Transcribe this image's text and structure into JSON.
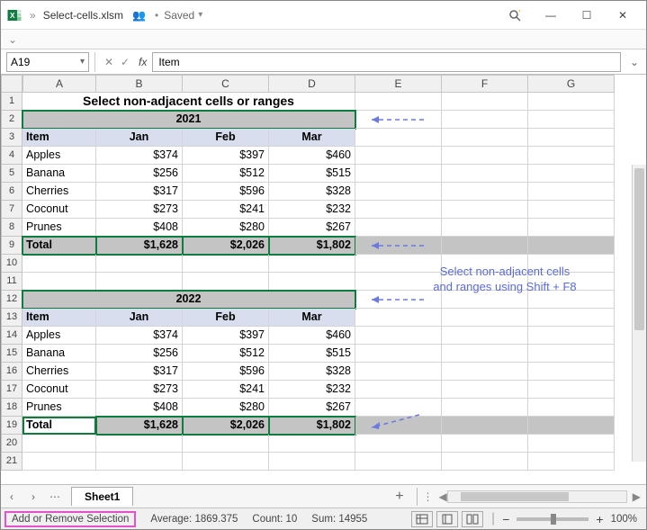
{
  "title": {
    "filename": "Select-cells.xlsm",
    "saved": "Saved"
  },
  "namebox": "A19",
  "formula": "Item",
  "colWidths": {
    "A": 82,
    "B": 96,
    "C": 96,
    "D": 96,
    "E": 96,
    "F": 96,
    "G": 96
  },
  "cols": [
    "A",
    "B",
    "C",
    "D",
    "E",
    "F",
    "G"
  ],
  "rows": [
    {
      "n": 1,
      "type": "title",
      "span": 4,
      "text": "Select non-adjacent cells or ranges"
    },
    {
      "n": 2,
      "type": "year",
      "span": 4,
      "text": "2021",
      "selected": true
    },
    {
      "n": 3,
      "type": "hdr",
      "cells": [
        "Item",
        "Jan",
        "Feb",
        "Mar"
      ]
    },
    {
      "n": 4,
      "type": "data",
      "cells": [
        "Apples",
        "$374",
        "$397",
        "$460"
      ]
    },
    {
      "n": 5,
      "type": "data",
      "cells": [
        "Banana",
        "$256",
        "$512",
        "$515"
      ]
    },
    {
      "n": 6,
      "type": "data",
      "cells": [
        "Cherries",
        "$317",
        "$596",
        "$328"
      ]
    },
    {
      "n": 7,
      "type": "data",
      "cells": [
        "Coconut",
        "$273",
        "$241",
        "$232"
      ]
    },
    {
      "n": 8,
      "type": "data",
      "cells": [
        "Prunes",
        "$408",
        "$280",
        "$267"
      ]
    },
    {
      "n": 9,
      "type": "total",
      "cells": [
        "Total",
        "$1,628",
        "$2,026",
        "$1,802"
      ],
      "selected": true
    },
    {
      "n": 10,
      "type": "blank"
    },
    {
      "n": 11,
      "type": "blank"
    },
    {
      "n": 12,
      "type": "year",
      "span": 4,
      "text": "2022",
      "selected": true
    },
    {
      "n": 13,
      "type": "hdr",
      "cells": [
        "Item",
        "Jan",
        "Feb",
        "Mar"
      ]
    },
    {
      "n": 14,
      "type": "data",
      "cells": [
        "Apples",
        "$374",
        "$397",
        "$460"
      ]
    },
    {
      "n": 15,
      "type": "data",
      "cells": [
        "Banana",
        "$256",
        "$512",
        "$515"
      ]
    },
    {
      "n": 16,
      "type": "data",
      "cells": [
        "Cherries",
        "$317",
        "$596",
        "$328"
      ]
    },
    {
      "n": 17,
      "type": "data",
      "cells": [
        "Coconut",
        "$273",
        "$241",
        "$232"
      ]
    },
    {
      "n": 18,
      "type": "data",
      "cells": [
        "Prunes",
        "$408",
        "$280",
        "$267"
      ]
    },
    {
      "n": 19,
      "type": "total",
      "cells": [
        "Total",
        "$1,628",
        "$2,026",
        "$1,802"
      ],
      "selected": true,
      "active": 0
    },
    {
      "n": 20,
      "type": "blank"
    },
    {
      "n": 21,
      "type": "blank"
    }
  ],
  "annotation": {
    "line1": "Select non-adjacent cells",
    "line2": "and ranges using Shift + F8"
  },
  "tab": "Sheet1",
  "status": {
    "mode": "Add or Remove Selection",
    "avg_label": "Average:",
    "avg": "1869.375",
    "count_label": "Count:",
    "count": "10",
    "sum_label": "Sum:",
    "sum": "14955",
    "zoom": "100%"
  }
}
